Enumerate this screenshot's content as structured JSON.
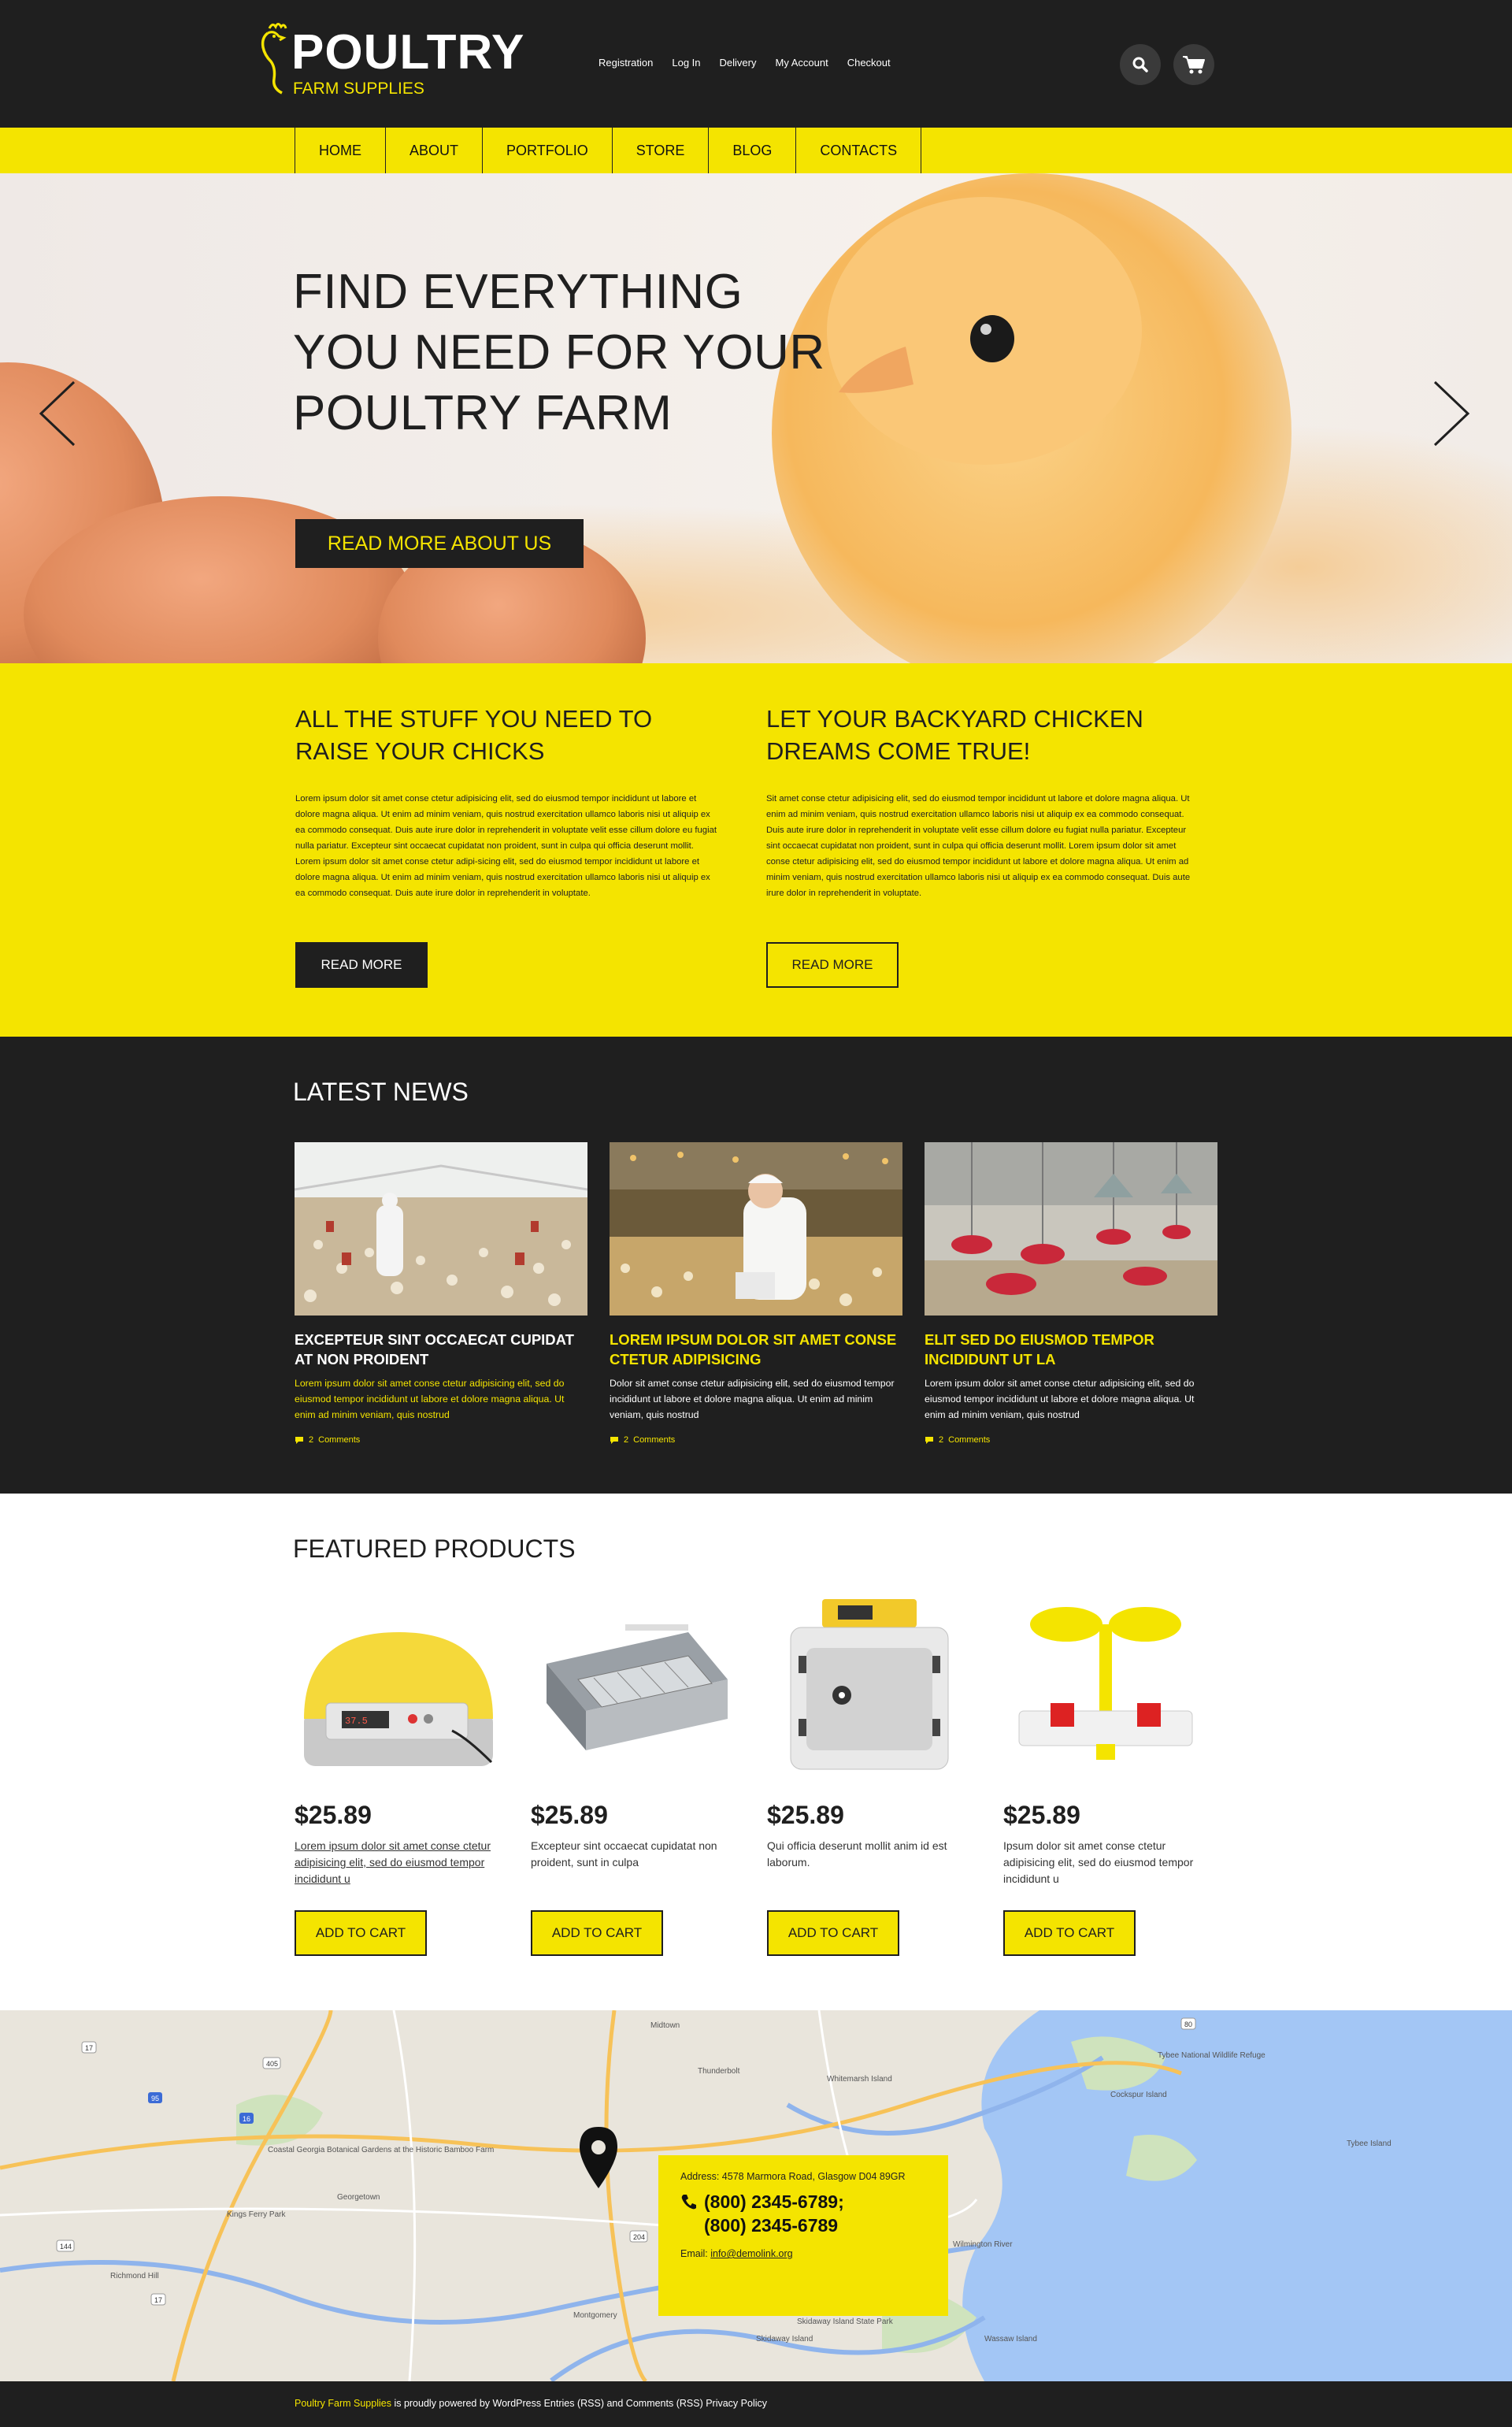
{
  "header": {
    "logo_title": "POULTRY",
    "logo_subtitle": "FARM SUPPLIES",
    "top_links": [
      "Registration",
      "Log In",
      "Delivery",
      "My Account",
      "Checkout"
    ],
    "search_icon": "search-icon",
    "cart_icon": "cart-icon"
  },
  "nav": {
    "items": [
      "HOME",
      "ABOUT",
      "PORTFOLIO",
      "STORE",
      "BLOG",
      "CONTACTS"
    ]
  },
  "hero": {
    "title_lines": [
      "FIND EVERYTHING",
      "YOU NEED FOR YOUR",
      "POULTRY FARM"
    ],
    "button": "READ MORE ABOUT US"
  },
  "intro": [
    {
      "title_lines": [
        "ALL THE STUFF YOU NEED TO",
        "RAISE YOUR CHICKS"
      ],
      "text": "Lorem ipsum dolor sit amet conse ctetur adipisicing elit, sed do eiusmod tempor incididunt ut labore et dolore magna aliqua. Ut enim ad minim veniam, quis nostrud exercitation ullamco laboris nisi ut aliquip ex ea commodo consequat. Duis aute irure dolor in reprehenderit in voluptate velit esse cillum dolore eu fugiat nulla pariatur. Excepteur sint occaecat cupidatat non proident, sunt in culpa qui officia deserunt mollit. Lorem ipsum dolor sit amet conse ctetur adipi-sicing elit, sed do eiusmod tempor incididunt ut labore et dolore magna aliqua. Ut enim ad minim veniam, quis nostrud exercitation ullamco laboris nisi ut aliquip ex ea commodo consequat. Duis aute irure dolor in reprehenderit in voluptate.",
      "button": "READ MORE"
    },
    {
      "title_lines": [
        "LET YOUR BACKYARD CHICKEN",
        "DREAMS COME TRUE!"
      ],
      "text": "Sit amet conse ctetur adipisicing elit, sed do eiusmod tempor incididunt ut labore et dolore magna aliqua. Ut enim ad minim veniam, quis nostrud exercitation ullamco laboris nisi ut aliquip ex ea commodo consequat. Duis aute irure dolor in reprehenderit in voluptate velit esse cillum dolore eu fugiat nulla pariatur. Excepteur sint occaecat cupidatat non proident, sunt in culpa qui officia deserunt mollit. Lorem ipsum dolor sit amet conse ctetur adipisicing elit, sed do eiusmod tempor incididunt ut labore et dolore magna aliqua. Ut enim ad minim veniam, quis nostrud exercitation ullamco laboris nisi ut aliquip ex ea commodo consequat. Duis aute irure dolor in reprehenderit in voluptate.",
      "button": "READ MORE"
    }
  ],
  "news": {
    "title": "LATEST NEWS",
    "items": [
      {
        "title": "EXCEPTEUR SINT OCCAECAT CUPIDAT AT NON PROIDENT",
        "text": "Lorem ipsum dolor sit amet conse ctetur adipisicing elit, sed do eiusmod tempor incididunt ut labore et dolore magna aliqua. Ut enim ad minim veniam, quis nostrud",
        "comments_count": "2",
        "comments_label": "Comments",
        "title_color": "#ffffff",
        "text_color": "#f4e400"
      },
      {
        "title": "LOREM IPSUM DOLOR SIT AMET CONSE CTETUR ADIPISICING",
        "text": "Dolor sit amet conse ctetur adipisicing elit, sed do eiusmod tempor incididunt ut labore et dolore magna aliqua. Ut enim ad minim veniam, quis nostrud",
        "comments_count": "2",
        "comments_label": "Comments",
        "title_color": "#f4e400",
        "text_color": "#ffffff"
      },
      {
        "title": "ELIT SED DO EIUSMOD TEMPOR INCIDIDUNT UT LA",
        "text": "Lorem ipsum dolor sit amet conse ctetur adipisicing elit, sed do eiusmod tempor incididunt ut labore et dolore magna aliqua. Ut enim ad minim veniam, quis nostrud",
        "comments_count": "2",
        "comments_label": "Comments",
        "title_color": "#f4e400",
        "text_color": "#ffffff"
      }
    ]
  },
  "products": {
    "title": "FEATURED PRODUCTS",
    "items": [
      {
        "price": "$25.89",
        "desc": "Lorem ipsum dolor sit amet conse ctetur adipisicing elit, sed do eiusmod tempor incididunt u",
        "button": "ADD TO CART"
      },
      {
        "price": "$25.89",
        "desc": "Excepteur sint occaecat cupidatat non proident, sunt in culpa",
        "button": "ADD TO CART"
      },
      {
        "price": "$25.89",
        "desc": "Qui officia deserunt mollit anim id est laborum.",
        "button": "ADD TO CART"
      },
      {
        "price": "$25.89",
        "desc": "Ipsum dolor sit amet conse ctetur adipisicing elit, sed do eiusmod tempor incididunt u",
        "button": "ADD TO CART"
      }
    ]
  },
  "map": {
    "labels": [
      "Midtown",
      "Thunderbolt",
      "Whitemarsh Island",
      "Tybee National Wildlife Refuge",
      "Cockspur Island",
      "Tybee Island",
      "Coastal Georgia Botanical Gardens at the Historic Bamboo Farm",
      "Kings Ferry Park",
      "Georgetown",
      "Skidaway Island State Park",
      "Skidaway Island",
      "Wassaw Island",
      "Montgomery",
      "Wilmington River",
      "Richmond Hill"
    ],
    "road_numbers": [
      "405",
      "16",
      "95",
      "17",
      "204",
      "144",
      "80",
      "17"
    ],
    "address": "Address: 4578 Marmora Road, Glasgow D04 89GR",
    "phones": [
      "(800) 2345-6789;",
      "(800) 2345-6789"
    ],
    "email_label": "Email:",
    "email": "info@demolink.org"
  },
  "footer": {
    "brand": "Poultry Farm Supplies",
    "text": " is proudly powered by WordPress ",
    "entries": "Entries (RSS)",
    "and": " and ",
    "comments": "Comments (RSS)",
    "privacy": " Privacy Policy"
  },
  "colors": {
    "accent": "#f4e400",
    "dark": "#1f1f1f",
    "map_water": "#a3c6f5"
  }
}
